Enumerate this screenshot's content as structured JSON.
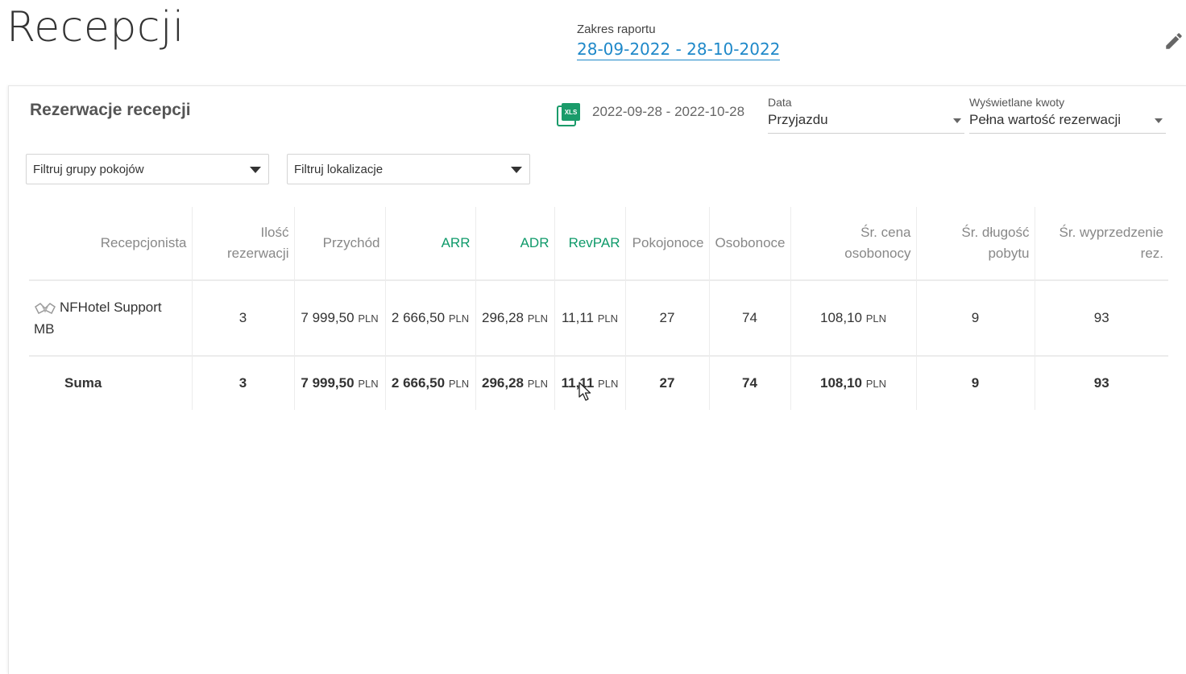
{
  "page": {
    "title": "Recepcji",
    "report_range_label": "Zakres raportu",
    "report_range_value": "28-09-2022 - 28-10-2022"
  },
  "card": {
    "title": "Rezerwacje recepcji",
    "date_range": "2022-09-28 - 2022-10-28",
    "date_select": {
      "label": "Data",
      "value": "Przyjazdu"
    },
    "amount_select": {
      "label": "Wyświetlane kwoty",
      "value": "Pełna wartość rezerwacji"
    },
    "filter_rooms": "Filtruj grupy pokojów",
    "filter_locations": "Filtruj lokalizacje",
    "xls_icon_text": "XLS"
  },
  "table": {
    "headers": {
      "receptionist": "Recepcjonista",
      "reservations_1": "Ilość",
      "reservations_2": "rezerwacji",
      "revenue": "Przychód",
      "arr": "ARR",
      "adr": "ADR",
      "revpar": "RevPAR",
      "room_nights": "Pokojonoce",
      "person_nights": "Osobonoce",
      "avg_price_1": "Śr. cena",
      "avg_price_2": "osobonocy",
      "avg_stay_1": "Śr. długość",
      "avg_stay_2": "pobytu",
      "avg_lead_1": "Śr. wyprzedzenie",
      "avg_lead_2": "rez."
    },
    "currency": "PLN",
    "rows": [
      {
        "name_1": "NFHotel Support",
        "name_2": "MB",
        "reservations": "3",
        "revenue": "7 999,50",
        "arr": "2 666,50",
        "adr": "296,28",
        "revpar": "11,11",
        "room_nights": "27",
        "person_nights": "74",
        "avg_price": "108,10",
        "avg_stay": "9",
        "avg_lead": "93"
      }
    ],
    "sum": {
      "label": "Suma",
      "reservations": "3",
      "revenue": "7 999,50",
      "arr": "2 666,50",
      "adr": "296,28",
      "revpar": "11,11",
      "room_nights": "27",
      "person_nights": "74",
      "avg_price": "108,10",
      "avg_stay": "9",
      "avg_lead": "93"
    }
  },
  "colors": {
    "link": "#1e88c9",
    "accent_green": "#0f9a6a"
  }
}
